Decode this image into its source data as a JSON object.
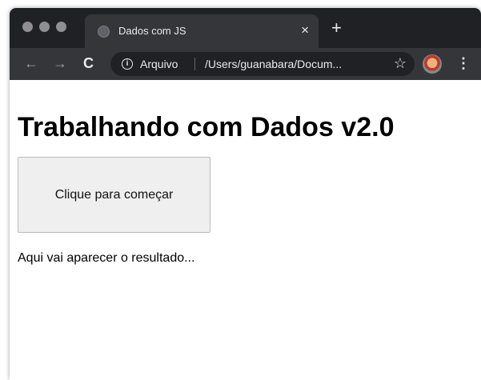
{
  "browser": {
    "tab": {
      "title": "Dados com JS",
      "close_label": "×"
    },
    "new_tab_label": "+",
    "nav": {
      "back": "←",
      "forward": "→",
      "reload": "C"
    },
    "omnibox": {
      "info_glyph": "i",
      "scheme_label": "Arquivo",
      "url": "/Users/guanabara/Docum...",
      "star": "☆"
    },
    "menu_glyph": "⋮"
  },
  "page": {
    "title": "Trabalhando com Dados v2.0",
    "button_label": "Clique para começar",
    "result_text": "Aqui vai aparecer o resultado..."
  },
  "colors": {
    "tabstrip": "#202124",
    "toolbar": "#35363a",
    "button_bg": "#efefef"
  }
}
